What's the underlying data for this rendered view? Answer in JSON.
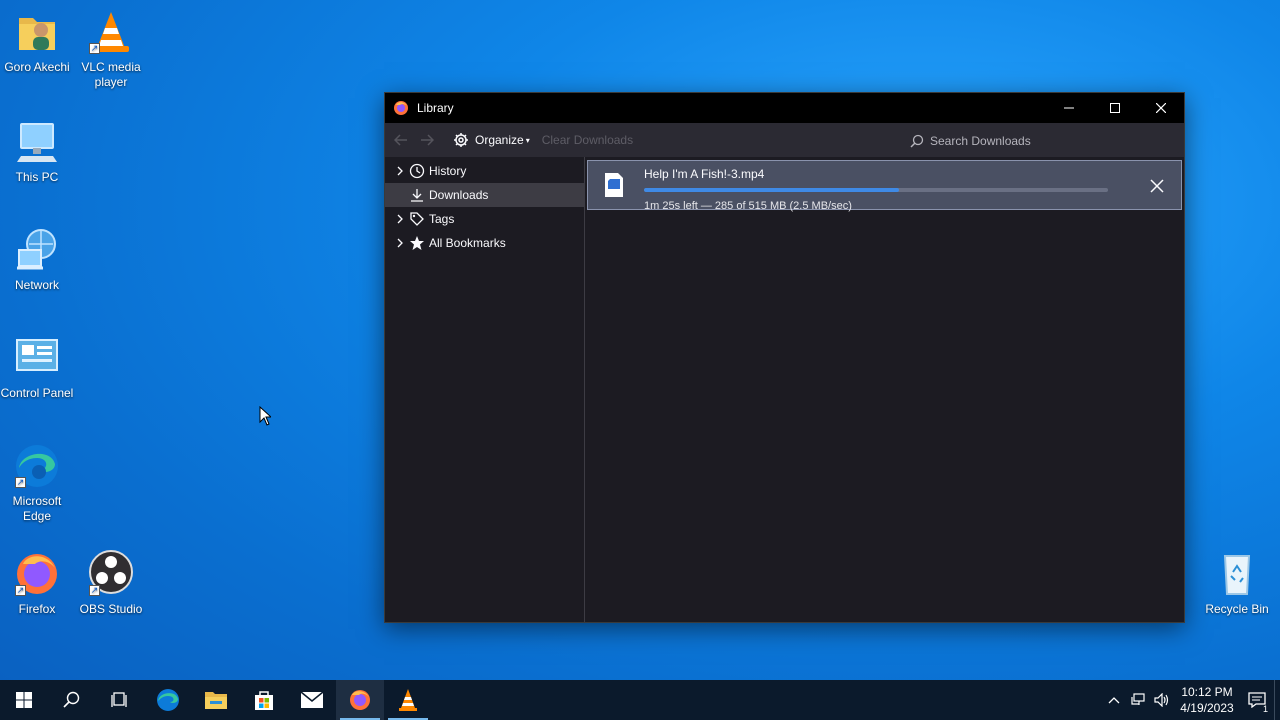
{
  "desktop": {
    "icons": [
      {
        "label": "Goro Akechi",
        "icon": "user-folder-icon"
      },
      {
        "label": "VLC media player",
        "icon": "vlc-cone-icon"
      },
      {
        "label": "This PC",
        "icon": "computer-icon"
      },
      {
        "label": "Network",
        "icon": "network-globe-icon"
      },
      {
        "label": "Control Panel",
        "icon": "control-panel-icon"
      },
      {
        "label": "Microsoft Edge",
        "icon": "edge-icon"
      },
      {
        "label": "Firefox",
        "icon": "firefox-icon"
      },
      {
        "label": "OBS Studio",
        "icon": "obs-icon"
      },
      {
        "label": "Recycle Bin",
        "icon": "recycle-bin-icon"
      }
    ]
  },
  "window": {
    "title": "Library",
    "toolbar": {
      "organize_label": "Organize",
      "clear_label": "Clear Downloads",
      "search_placeholder": "Search Downloads"
    },
    "sidebar": {
      "items": [
        {
          "label": "History",
          "icon": "clock-icon",
          "expandable": true
        },
        {
          "label": "Downloads",
          "icon": "download-icon",
          "expandable": false,
          "selected": true
        },
        {
          "label": "Tags",
          "icon": "tag-icon",
          "expandable": true
        },
        {
          "label": "All Bookmarks",
          "icon": "star-icon",
          "expandable": true
        }
      ]
    },
    "downloads": [
      {
        "filename": "Help I'm A Fish!-3.mp4",
        "status": "1m 25s left — 285 of 515 MB (2.5 MB/sec)",
        "progress": 0.55
      }
    ]
  },
  "taskbar": {
    "clock_time": "10:12 PM",
    "clock_date": "4/19/2023",
    "notification_count": "1"
  },
  "colors": {
    "accent": "#3f8ae6",
    "window_bg": "#1c1b22",
    "toolbar_bg": "#2b2a33",
    "selected_bg": "#3d3c44"
  }
}
